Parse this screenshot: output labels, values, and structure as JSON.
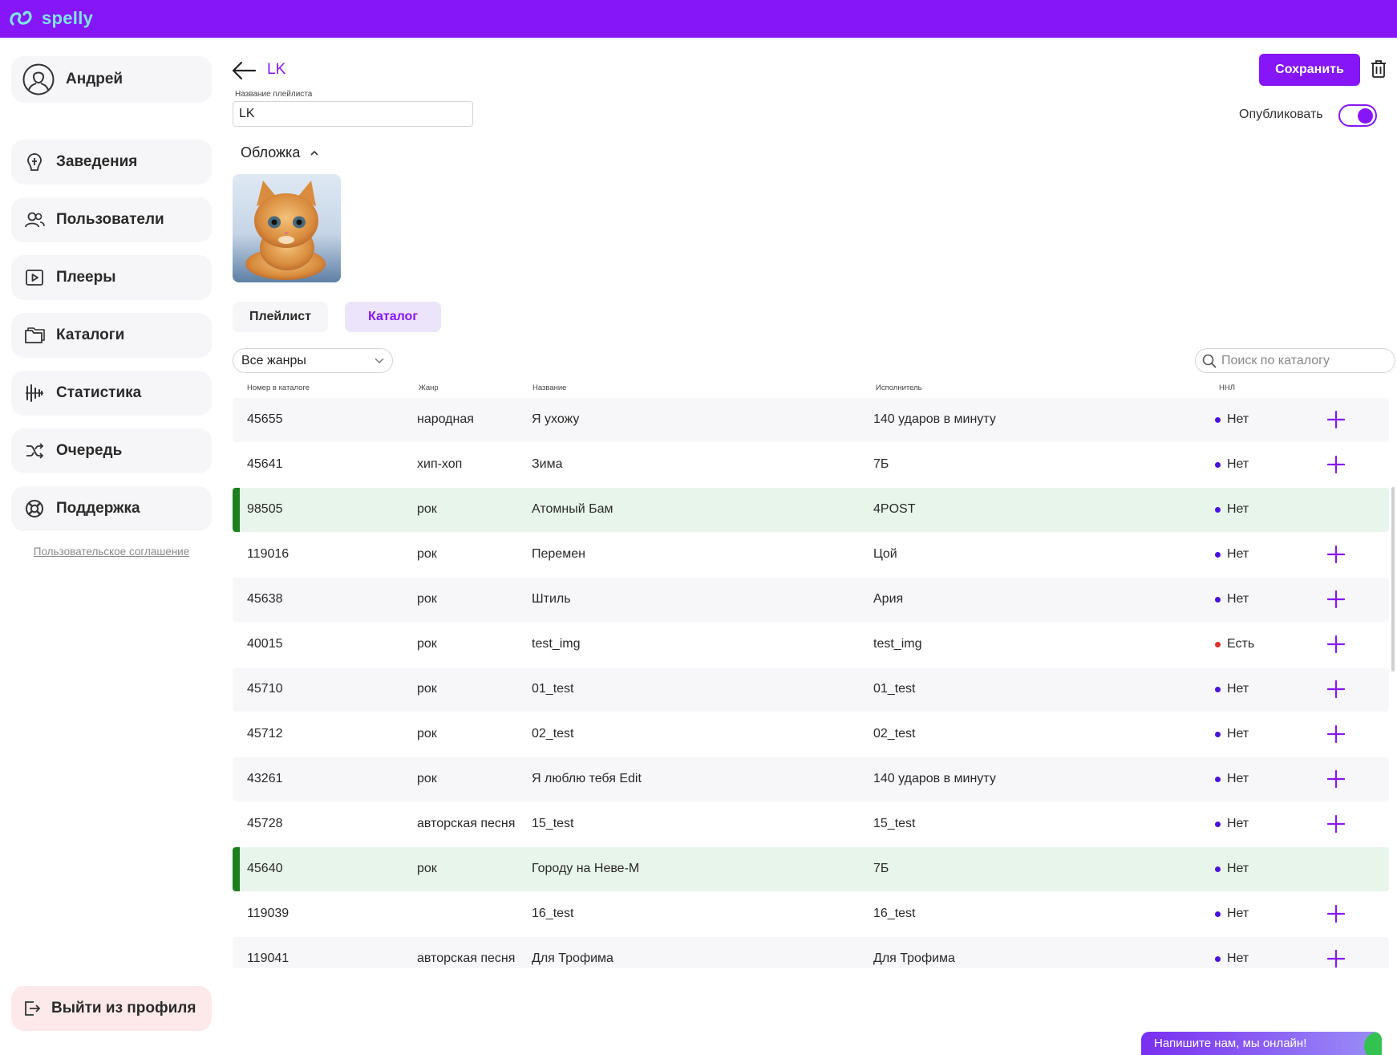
{
  "app": {
    "logo_text": "spelly",
    "accent": "#8616f7"
  },
  "sidebar": {
    "user_name": "Андрей",
    "items": [
      {
        "label": "Заведения",
        "icon": "venue-icon"
      },
      {
        "label": "Пользователи",
        "icon": "users-icon"
      },
      {
        "label": "Плееры",
        "icon": "player-icon"
      },
      {
        "label": "Каталоги",
        "icon": "folder-icon"
      },
      {
        "label": "Статистика",
        "icon": "statistics-icon"
      },
      {
        "label": "Очередь",
        "icon": "shuffle-icon"
      },
      {
        "label": "Поддержка",
        "icon": "lifebuoy-icon"
      }
    ],
    "agreement": "Пользовательское соглашение",
    "logout": "Выйти из профиля"
  },
  "header": {
    "title": "LK",
    "name_label": "Название плейлиста",
    "name_value": "LK",
    "save": "Сохранить",
    "publish": "Опубликовать",
    "published": true
  },
  "cover": {
    "title": "Обложка"
  },
  "tabs": [
    {
      "label": "Плейлист",
      "active": false
    },
    {
      "label": "Каталог",
      "active": true
    }
  ],
  "filters": {
    "genre_selected": "Все жанры",
    "search_placeholder": "Поиск по каталогу"
  },
  "table": {
    "columns": [
      "Номер в каталоге",
      "Жанр",
      "Название",
      "Исполнитель",
      "ННЛ"
    ],
    "rows": [
      {
        "num": "45655",
        "genre": "народная",
        "title": "Я ухожу",
        "artist": "140 ударов в минуту",
        "hnl": "Нет",
        "added": false
      },
      {
        "num": "45641",
        "genre": "хип-хоп",
        "title": "Зима",
        "artist": "7Б",
        "hnl": "Нет",
        "added": false
      },
      {
        "num": "98505",
        "genre": "рок",
        "title": "Атомный Бам",
        "artist": "4POST",
        "hnl": "Нет",
        "added": true
      },
      {
        "num": "119016",
        "genre": "рок",
        "title": "Перемен",
        "artist": "Цой",
        "hnl": "Нет",
        "added": false
      },
      {
        "num": "45638",
        "genre": "рок",
        "title": "Штиль",
        "artist": "Ария",
        "hnl": "Нет",
        "added": false
      },
      {
        "num": "40015",
        "genre": "рок",
        "title": "test_img",
        "artist": "test_img",
        "hnl": "Есть",
        "added": false
      },
      {
        "num": "45710",
        "genre": "рок",
        "title": "01_test",
        "artist": "01_test",
        "hnl": "Нет",
        "added": false
      },
      {
        "num": "45712",
        "genre": "рок",
        "title": "02_test",
        "artist": "02_test",
        "hnl": "Нет",
        "added": false
      },
      {
        "num": "43261",
        "genre": "рок",
        "title": "Я люблю тебя Edit",
        "artist": "140 ударов в минуту",
        "hnl": "Нет",
        "added": false
      },
      {
        "num": "45728",
        "genre": "авторская песня",
        "title": "15_test",
        "artist": "15_test",
        "hnl": "Нет",
        "added": false
      },
      {
        "num": "45640",
        "genre": "рок",
        "title": "Городу на Неве-М",
        "artist": "7Б",
        "hnl": "Нет",
        "added": true
      },
      {
        "num": "119039",
        "genre": "",
        "title": "16_test",
        "artist": "16_test",
        "hnl": "Нет",
        "added": false
      },
      {
        "num": "119041",
        "genre": "авторская песня",
        "title": "Для Трофима",
        "artist": "Для Трофима",
        "hnl": "Нет",
        "added": false
      }
    ],
    "hnl_colors": {
      "Нет": "#4a10e0",
      "Есть": "#e0302a"
    }
  },
  "chat": {
    "label": "Напишите нам, мы онлайн!"
  }
}
